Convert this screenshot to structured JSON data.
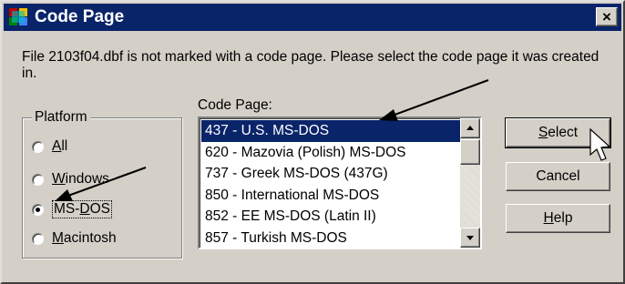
{
  "window": {
    "title": "Code Page",
    "close_label": "×",
    "app_icon": "app-icon"
  },
  "message": "File 2103f04.dbf is not marked with a code page.  Please select the code page it was created in.",
  "platform": {
    "group_label": "Platform",
    "options": [
      {
        "pre": "",
        "key": "A",
        "post": "ll",
        "checked": false
      },
      {
        "pre": "",
        "key": "W",
        "post": "indows",
        "checked": false
      },
      {
        "pre": "MS-",
        "key": "D",
        "post": "OS",
        "checked": true
      },
      {
        "pre": "",
        "key": "M",
        "post": "acintosh",
        "checked": false
      }
    ]
  },
  "code_page": {
    "label": "Code Page:",
    "items": [
      "437 - U.S. MS-DOS",
      "620 - Mazovia (Polish) MS-DOS",
      "737 - Greek MS-DOS (437G)",
      "850 - International MS-DOS",
      "852 - EE MS-DOS (Latin II)",
      "857 - Turkish MS-DOS"
    ],
    "selected_index": 0
  },
  "buttons": {
    "select": {
      "key": "S",
      "rest": "elect"
    },
    "cancel": {
      "label": "Cancel"
    },
    "help": {
      "key": "H",
      "rest": "elp"
    }
  },
  "annotations": {
    "arrow_color": "#000000"
  },
  "colors": {
    "titlebar": "#0a246a",
    "dialog_face": "#d4d0c8",
    "selection": "#0a246a"
  }
}
